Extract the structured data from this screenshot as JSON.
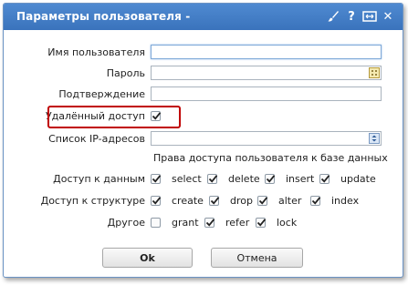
{
  "dialog": {
    "title": "Параметры пользователя -",
    "icons": [
      "brush-icon",
      "help-icon",
      "maximize-icon",
      "close-icon"
    ],
    "help_glyph": "?",
    "close_glyph": "✕"
  },
  "form": {
    "username_label": "Имя пользователя",
    "username_value": "",
    "password_label": "Пароль",
    "password_value": "",
    "confirm_label": "Подтверждение",
    "confirm_value": "",
    "remote_access_label": "Удалённый доступ",
    "remote_access_checked": true,
    "ip_list_label": "Список IP-адресов",
    "ip_list_value": ""
  },
  "permissions": {
    "header": "Права доступа пользователя к базе данных",
    "rows": [
      {
        "label": "Доступ к данным",
        "items": [
          {
            "label": "select",
            "checked": true
          },
          {
            "label": "delete",
            "checked": true
          },
          {
            "label": "insert",
            "checked": true
          },
          {
            "label": "update",
            "checked": true
          }
        ]
      },
      {
        "label": "Доступ к структуре",
        "items": [
          {
            "label": "create",
            "checked": true
          },
          {
            "label": "drop",
            "checked": true
          },
          {
            "label": "alter",
            "checked": true
          },
          {
            "label": "index",
            "checked": true
          }
        ]
      },
      {
        "label": "Другое",
        "items": [
          {
            "label": "grant",
            "checked": false
          },
          {
            "label": "refer",
            "checked": true
          },
          {
            "label": "lock",
            "checked": true
          }
        ]
      }
    ]
  },
  "buttons": {
    "ok_label": "Ok",
    "cancel_label": "Отмена"
  },
  "colors": {
    "titlebar": "#3f7cc6",
    "highlight": "#c00000"
  }
}
